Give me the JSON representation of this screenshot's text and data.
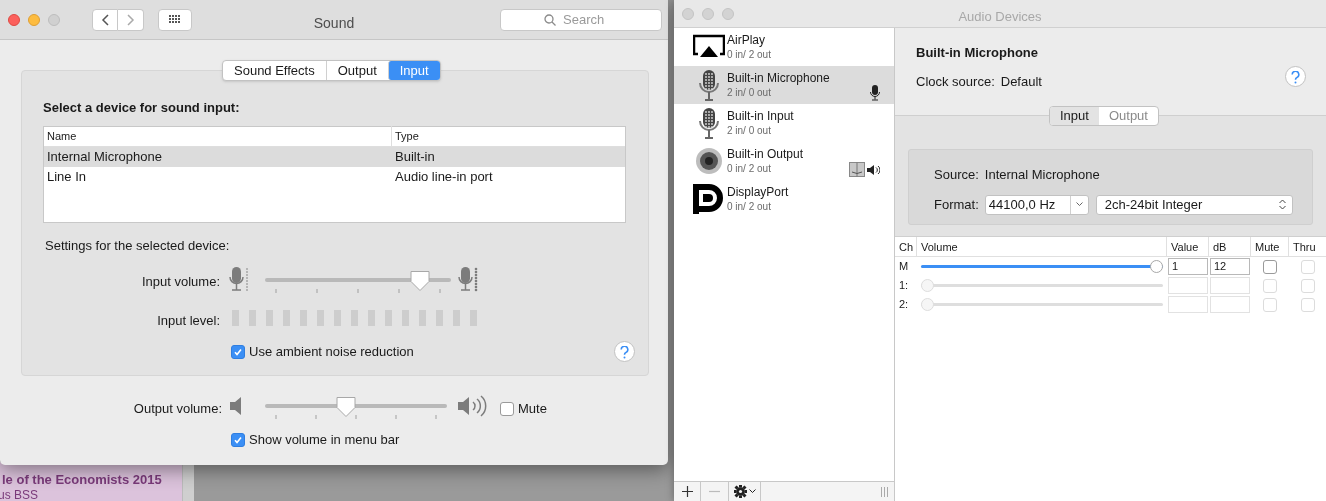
{
  "background": {
    "lines": [
      "le of the Economists 2015",
      "us BSS"
    ]
  },
  "sound_window": {
    "title": "Sound",
    "search": {
      "placeholder": "Search"
    },
    "tabs": [
      {
        "label": "Sound Effects",
        "selected": false
      },
      {
        "label": "Output",
        "selected": false
      },
      {
        "label": "Input",
        "selected": true
      }
    ],
    "device_heading": "Select a device for sound input:",
    "device_table": {
      "columns": [
        "Name",
        "Type"
      ],
      "rows": [
        {
          "cells": [
            "Internal Microphone",
            "Built-in"
          ],
          "selected": true
        },
        {
          "cells": [
            "Line In",
            "Audio line-in port"
          ],
          "selected": false
        }
      ]
    },
    "settings_heading": "Settings for the selected device:",
    "input_volume": {
      "label": "Input volume:",
      "level": 0.88
    },
    "input_level": {
      "label": "Input level:",
      "level": 0
    },
    "ambient": {
      "label": "Use ambient noise reduction",
      "checked": true
    },
    "output_volume": {
      "label": "Output volume:",
      "level": 0.44
    },
    "mute": {
      "label": "Mute",
      "checked": false
    },
    "show_volume": {
      "label": "Show volume in menu bar",
      "checked": true
    }
  },
  "audio_window": {
    "title": "Audio Devices",
    "devices": [
      {
        "kind": "airplay",
        "name": "AirPlay",
        "io": "0 in/ 2 out",
        "selected": false,
        "default_input": false,
        "default_output": false
      },
      {
        "kind": "microphone",
        "name": "Built-in Microphone",
        "io": "2 in/ 0 out",
        "selected": true,
        "default_input": true,
        "default_output": false
      },
      {
        "kind": "microphone",
        "name": "Built-in Input",
        "io": "2 in/ 0 out",
        "selected": false,
        "default_input": false,
        "default_output": false
      },
      {
        "kind": "speaker",
        "name": "Built-in Output",
        "io": "0 in/ 2 out",
        "selected": false,
        "default_input": false,
        "default_output": true
      },
      {
        "kind": "displayport",
        "name": "DisplayPort",
        "io": "0 in/ 2 out",
        "selected": false,
        "default_input": false,
        "default_output": false
      }
    ],
    "detail": {
      "heading": "Built-in Microphone",
      "clock_label": "Clock source:",
      "clock_value": "Default",
      "tabs": [
        {
          "label": "Input",
          "selected": true
        },
        {
          "label": "Output",
          "selected": false
        }
      ],
      "source_label": "Source:",
      "source_value": "Internal Microphone",
      "format_label": "Format:",
      "rate": "44100,0 Hz",
      "format": "2ch-24bit Integer",
      "columns": [
        "Ch",
        "Volume",
        "Value",
        "dB",
        "Mute",
        "Thru"
      ],
      "channels": [
        {
          "ch": "M",
          "level": 1,
          "value": "1",
          "db": "12",
          "enabled": true,
          "mute": false,
          "thru": false
        },
        {
          "ch": "1:",
          "level": 0,
          "enabled": false,
          "mute": false,
          "thru": false
        },
        {
          "ch": "2:",
          "level": 0,
          "enabled": false,
          "mute": false,
          "thru": false
        }
      ]
    }
  }
}
